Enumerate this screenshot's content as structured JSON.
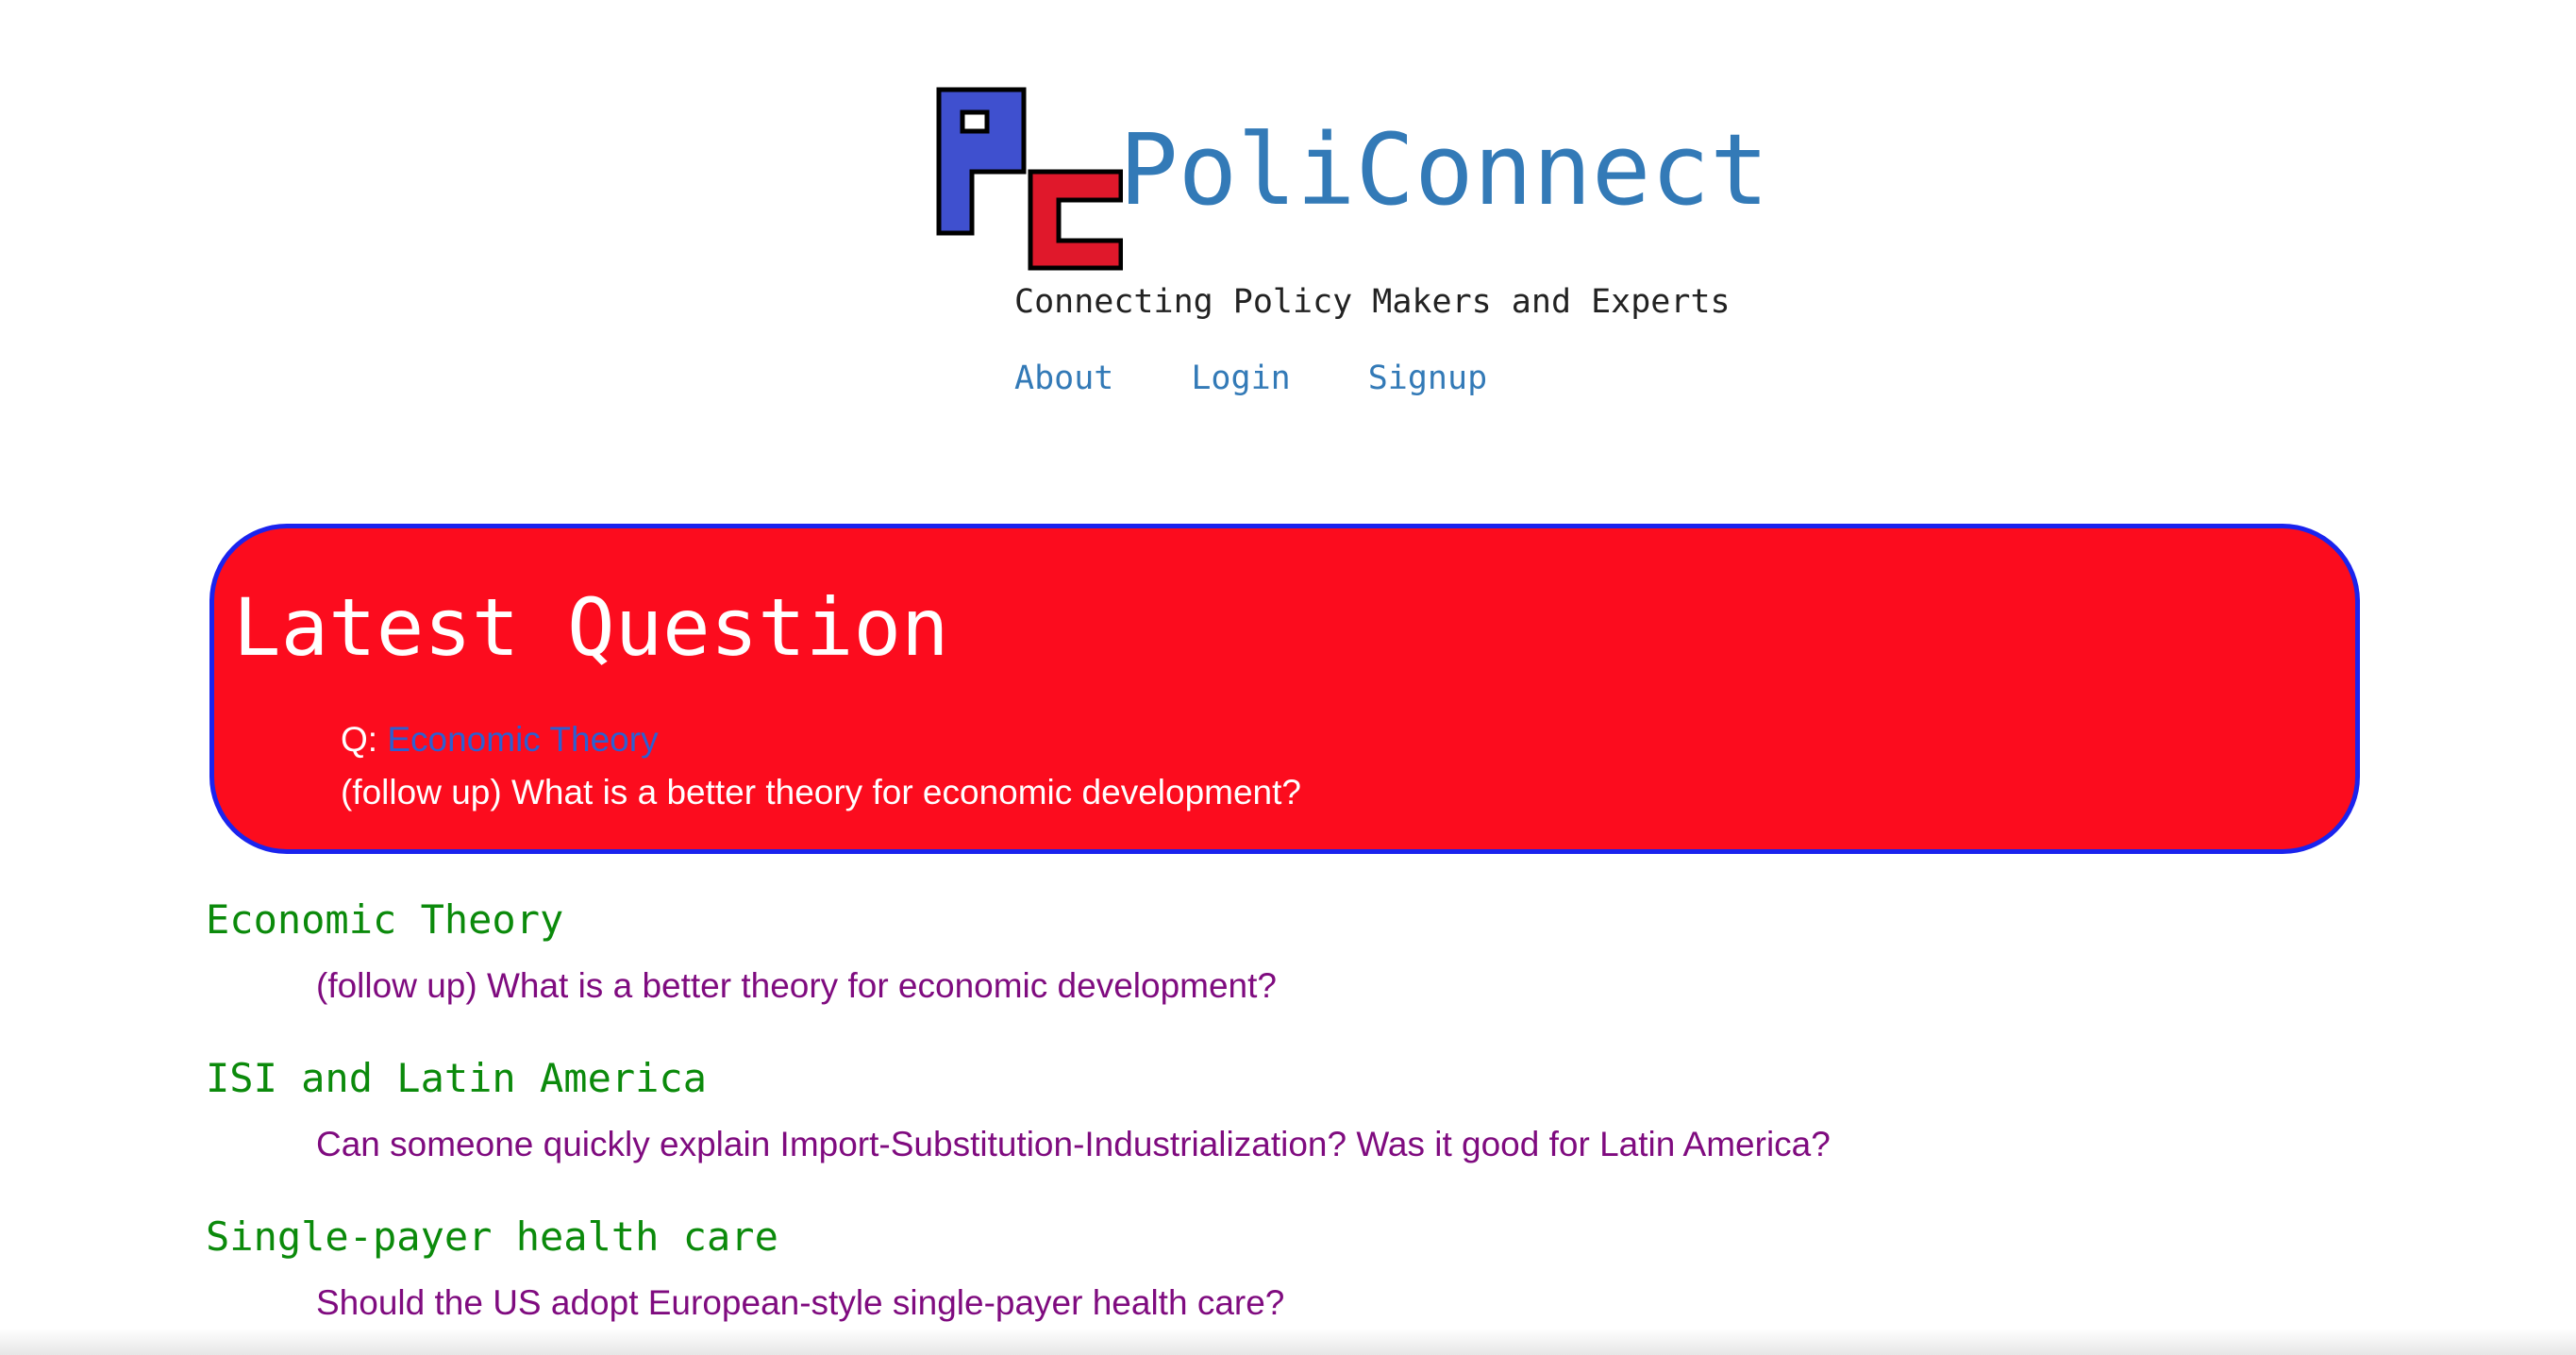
{
  "header": {
    "brand": "PoliConnect",
    "tagline": "Connecting Policy Makers and Experts"
  },
  "nav": {
    "items": [
      {
        "label": "About"
      },
      {
        "label": "Login"
      },
      {
        "label": "Signup"
      }
    ]
  },
  "latest": {
    "title": "Latest Question",
    "q_prefix": "Q:",
    "q_link": "Economic Theory",
    "q_text": "(follow up) What is a better theory for economic development?"
  },
  "questions": [
    {
      "title": "Economic Theory",
      "text": "(follow up) What is a better theory for economic development?"
    },
    {
      "title": "ISI and Latin America",
      "text": "Can someone quickly explain Import-Substitution-Industrialization? Was it good for Latin America?"
    },
    {
      "title": "Single-payer health care",
      "text": "Should the US adopt European-style single-payer health care?"
    }
  ],
  "colors": {
    "brand_blue": "#337ab7",
    "panel_red": "#fc0c1e",
    "panel_border": "#1a23ee",
    "title_green": "#0b8a0b",
    "text_purple": "#7f0b7f"
  },
  "icons": {
    "logo": "pc-logo-icon"
  }
}
